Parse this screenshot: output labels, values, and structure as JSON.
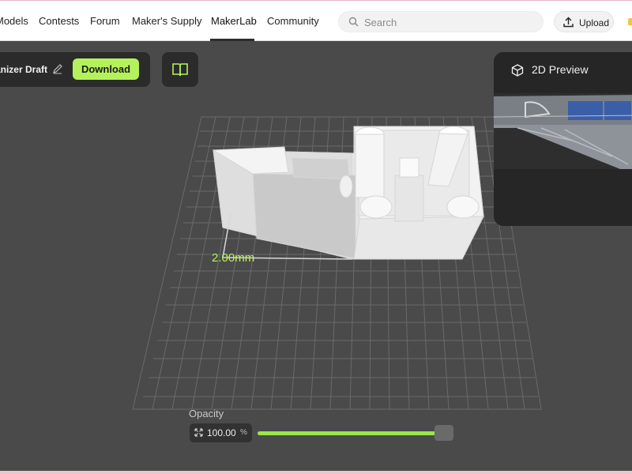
{
  "nav": {
    "items": [
      "Models",
      "Contests",
      "Forum",
      "Maker's Supply",
      "MakerLab",
      "Community"
    ],
    "active": "MakerLab"
  },
  "search": {
    "placeholder": "Search",
    "value": ""
  },
  "upload": {
    "label": "Upload"
  },
  "draft": {
    "name": "Parametric Organizer Draft",
    "download_label": "Download"
  },
  "preview": {
    "title": "2D Preview"
  },
  "viewport": {
    "dimension_label": "2.00mm"
  },
  "opacity": {
    "label": "Opacity",
    "value": "100.00",
    "unit": "%",
    "level": 1.0
  },
  "colors": {
    "accent": "#b4f25c",
    "panel": "#2b2b2b",
    "background": "#4a4a4a"
  },
  "icons": [
    "search-icon",
    "upload-icon",
    "edit-icon",
    "book-icon",
    "cube-icon",
    "expand-icon"
  ]
}
